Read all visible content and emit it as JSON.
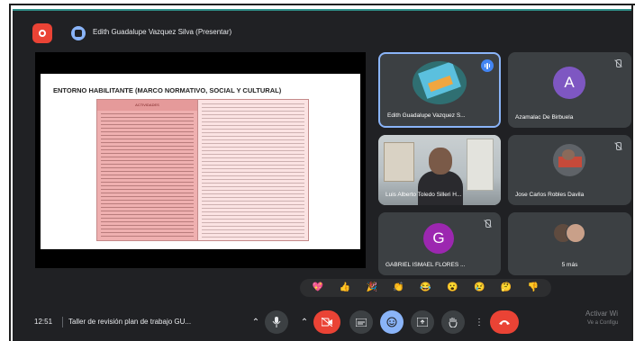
{
  "header": {
    "presenter_title": "Edith Guadalupe Vazquez Silva (Presentar)"
  },
  "slide": {
    "title": "ENTORNO HABILITANTE (MARCO NORMATIVO, SOCIAL Y CULTURAL)",
    "table_header": "ACTIVIDADES"
  },
  "participants": [
    {
      "name": "Edith Guadalupe Vazquez S...",
      "avatar": "",
      "speaking": true
    },
    {
      "name": "Azamalac De Birbuela",
      "avatar": "A",
      "avatar_color": "#7e57c2"
    },
    {
      "name": "Luis Alberto Toledo Silleri H..."
    },
    {
      "name": "Jose Carlos Robles Davila"
    },
    {
      "name": "GABRIEL ISMAEL FLORES ...",
      "avatar": "G",
      "avatar_color": "#9c27b0"
    },
    {
      "name": "5 más"
    }
  ],
  "reactions": [
    "💖",
    "👍",
    "🎉",
    "👏",
    "😂",
    "😮",
    "😢",
    "🤔",
    "👎"
  ],
  "footer": {
    "time": "12:51",
    "meeting_title": "Taller de revisión plan de trabajo GU...",
    "watermark_line1": "Activar Wi",
    "watermark_line2": "Ve a Configu"
  },
  "colors": {
    "background": "#202124",
    "tile": "#3c4043",
    "accent_blue": "#8ab4f8",
    "danger_red": "#ea4335"
  },
  "icons": [
    "record-icon",
    "present-icon",
    "mic-icon",
    "camera-off-icon",
    "captions-icon",
    "emoji-icon",
    "present-now-icon",
    "raise-hand-icon",
    "more-options-icon",
    "end-call-icon"
  ]
}
